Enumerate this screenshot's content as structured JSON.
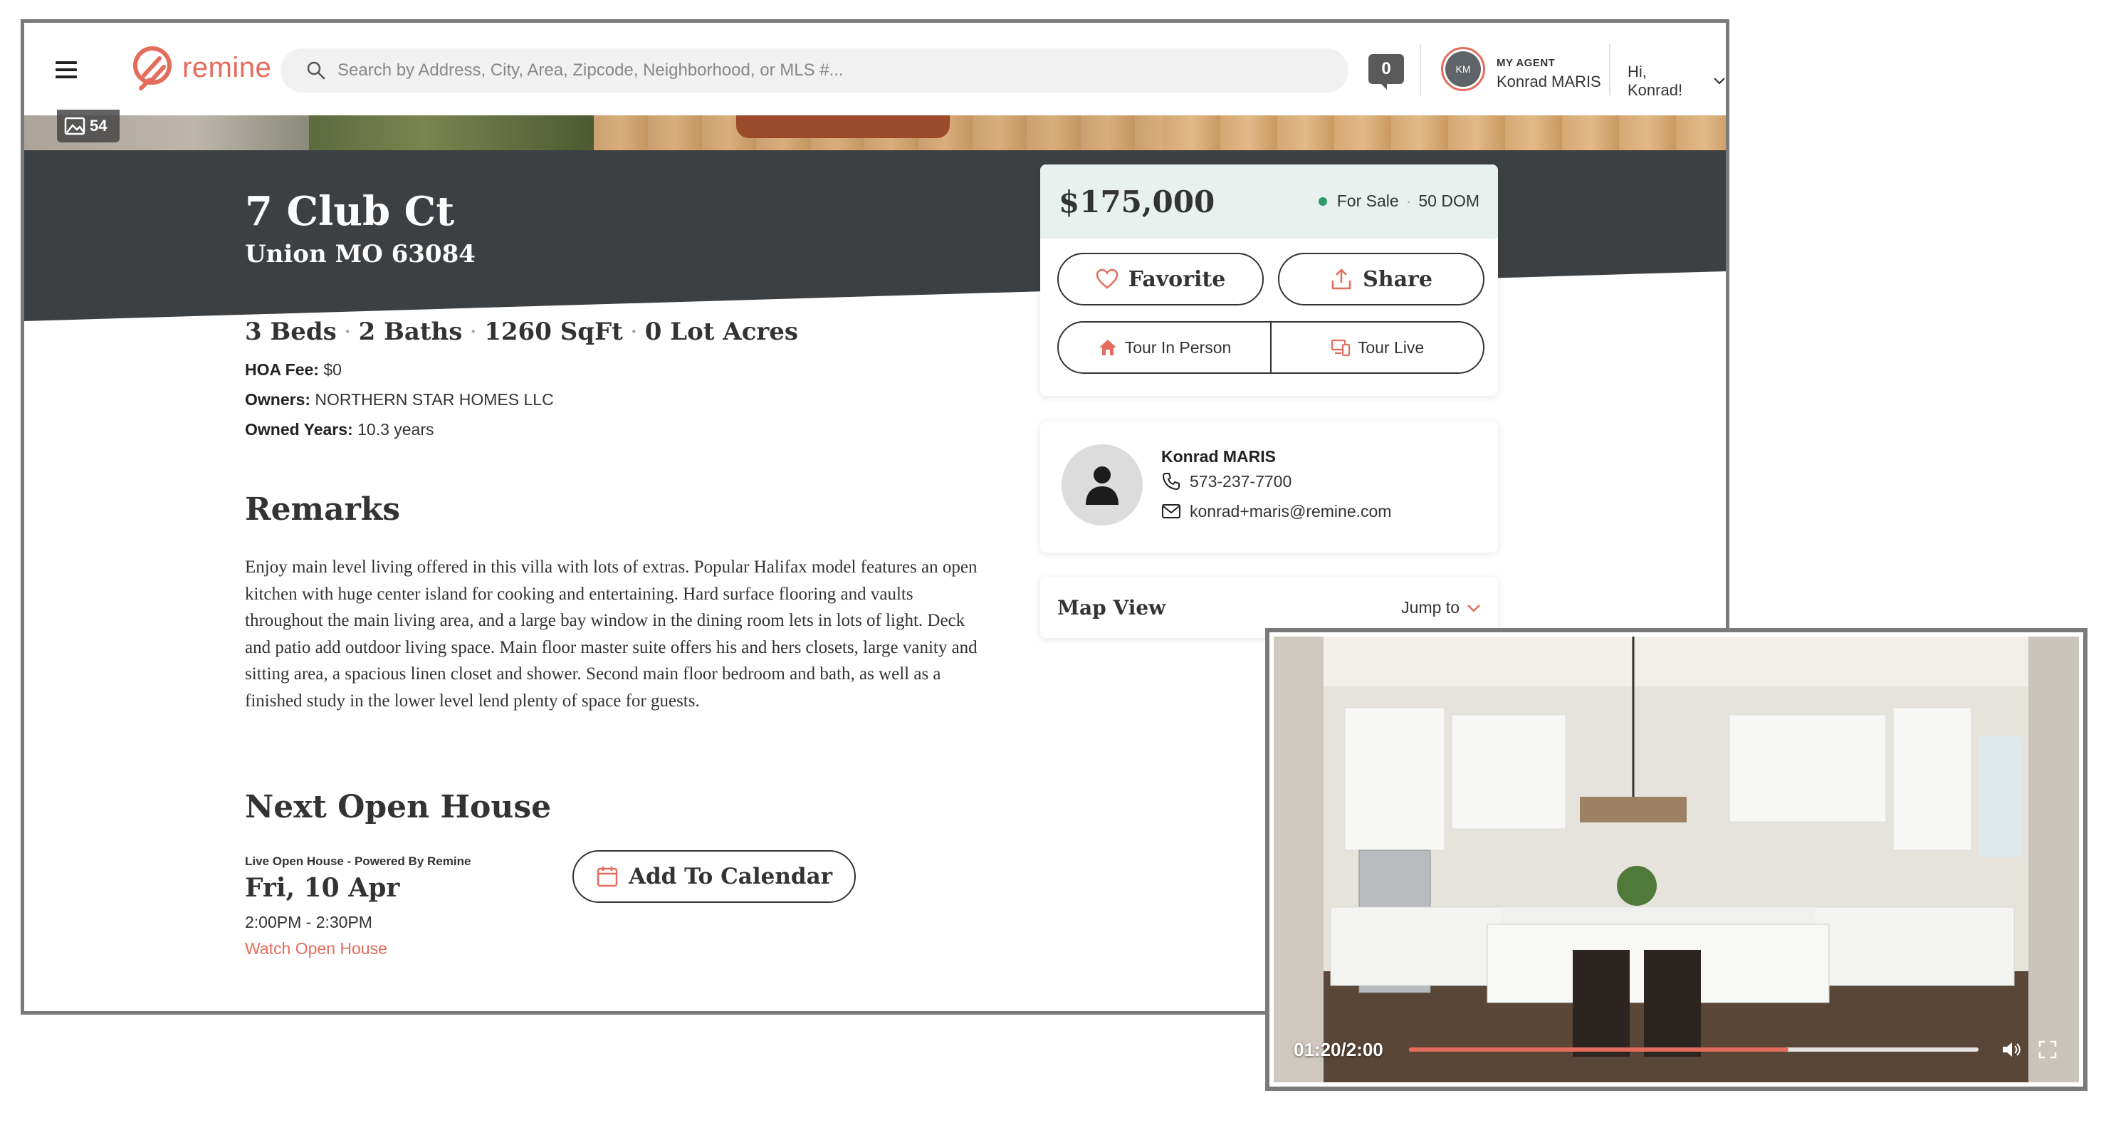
{
  "header": {
    "logo_text": "remine",
    "search_placeholder": "Search by Address, City, Area, Zipcode, Neighborhood, or MLS #...",
    "notification_count": "0",
    "agent_initials": "KM",
    "agent_label": "MY AGENT",
    "agent_name": "Konrad MARIS",
    "greeting": "Hi, Konrad!"
  },
  "gallery": {
    "photo_count": "54"
  },
  "property": {
    "address_line1": "7 Club Ct",
    "address_line2": "Union MO 63084",
    "beds": "3 Beds",
    "baths": "2 Baths",
    "sqft": "1260 SqFt",
    "lot": "0 Lot Acres",
    "hoa_label": "HOA Fee:",
    "hoa_value": "$0",
    "owners_label": "Owners:",
    "owners_value": "NORTHERN STAR HOMES LLC",
    "owned_years_label": "Owned Years:",
    "owned_years_value": "10.3 years"
  },
  "remarks": {
    "title": "Remarks",
    "text": "Enjoy main level living offered in this villa with lots of extras. Popular Halifax model features an open kitchen with huge center island for cooking and entertaining. Hard surface flooring and vaults throughout the main living area, and a large bay window in the dining room lets in lots of light. Deck and patio add outdoor living space. Main floor master suite offers his and hers closets, large vanity and sitting area, a spacious linen closet and shower. Second main floor bedroom and bath, as well as a finished study in the lower level lend plenty of space for guests."
  },
  "open_house": {
    "title": "Next Open House",
    "label": "Live Open House - Powered By Remine",
    "date": "Fri, 10 Apr",
    "time": "2:00PM - 2:30PM",
    "watch_link": "Watch Open House",
    "add_calendar": "Add To Calendar"
  },
  "listing": {
    "price": "$175,000",
    "status": "For Sale",
    "dom": "50 DOM",
    "favorite": "Favorite",
    "share": "Share",
    "tour_in_person": "Tour In Person",
    "tour_live": "Tour Live"
  },
  "agent_card": {
    "name": "Konrad MARIS",
    "phone": "573-237-7700",
    "email": "konrad+maris@remine.com"
  },
  "map": {
    "title": "Map View",
    "jump_to": "Jump to"
  },
  "video": {
    "time": "01:20/2:00",
    "progress": 0.6667
  },
  "colors": {
    "accent": "#e46c5c",
    "dark_band": "#3d4042",
    "status_green": "#2e9a6a",
    "price_bg": "#e8f1ee"
  }
}
